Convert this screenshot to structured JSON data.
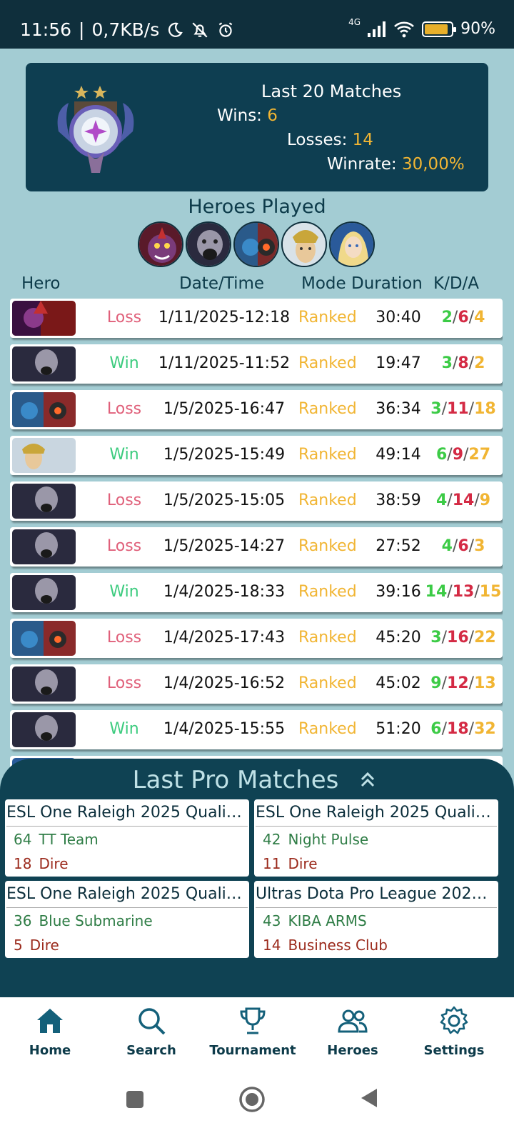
{
  "status_bar": {
    "time": "11:56",
    "speed": "0,7KB/s",
    "network": "4G",
    "battery": "90%",
    "battery_level": 0.9,
    "icons": [
      "moon-icon",
      "bell-off-icon",
      "alarm-icon",
      "signal-icon",
      "wifi-icon",
      "battery-icon"
    ]
  },
  "summary": {
    "title": "Last 20 Matches",
    "wins_label": "Wins: ",
    "wins": "6",
    "losses_label": "Losses: ",
    "losses": "14",
    "winrate_label": "Winrate: ",
    "winrate": "30,00%"
  },
  "heroes_played": {
    "title": "Heroes Played",
    "count": 5
  },
  "columns": {
    "hero": "Hero",
    "datetime": "Date/Time",
    "mode_duration": "Mode Duration",
    "kda": "K/D/A"
  },
  "matches": [
    {
      "result": "Loss",
      "datetime": "1/11/2025-12:18",
      "mode": "Ranked",
      "duration": "30:40",
      "k": "2",
      "d": "6",
      "a": "4"
    },
    {
      "result": "Win",
      "datetime": "1/11/2025-11:52",
      "mode": "Ranked",
      "duration": "19:47",
      "k": "3",
      "d": "8",
      "a": "2"
    },
    {
      "result": "Loss",
      "datetime": "1/5/2025-16:47",
      "mode": "Ranked",
      "duration": "36:34",
      "k": "3",
      "d": "11",
      "a": "18"
    },
    {
      "result": "Win",
      "datetime": "1/5/2025-15:49",
      "mode": "Ranked",
      "duration": "49:14",
      "k": "6",
      "d": "9",
      "a": "27"
    },
    {
      "result": "Loss",
      "datetime": "1/5/2025-15:05",
      "mode": "Ranked",
      "duration": "38:59",
      "k": "4",
      "d": "14",
      "a": "9"
    },
    {
      "result": "Loss",
      "datetime": "1/5/2025-14:27",
      "mode": "Ranked",
      "duration": "27:52",
      "k": "4",
      "d": "6",
      "a": "3"
    },
    {
      "result": "Win",
      "datetime": "1/4/2025-18:33",
      "mode": "Ranked",
      "duration": "39:16",
      "k": "14",
      "d": "13",
      "a": "15"
    },
    {
      "result": "Loss",
      "datetime": "1/4/2025-17:43",
      "mode": "Ranked",
      "duration": "45:20",
      "k": "3",
      "d": "16",
      "a": "22"
    },
    {
      "result": "Loss",
      "datetime": "1/4/2025-16:52",
      "mode": "Ranked",
      "duration": "45:02",
      "k": "9",
      "d": "12",
      "a": "13"
    },
    {
      "result": "Win",
      "datetime": "1/4/2025-15:55",
      "mode": "Ranked",
      "duration": "51:20",
      "k": "6",
      "d": "18",
      "a": "32"
    }
  ],
  "pro_matches": {
    "title": "Last Pro Matches",
    "items": [
      {
        "league": "ESL One Raleigh 2025 Qualifi…",
        "team1_score": "64",
        "team1": "TT Team",
        "team2_score": "18",
        "team2": "Dire"
      },
      {
        "league": "ESL One Raleigh 2025 Qualifi…",
        "team1_score": "42",
        "team1": "Night Pulse",
        "team2_score": "11",
        "team2": "Dire"
      },
      {
        "league": "ESL One Raleigh 2025 Qualifi…",
        "team1_score": "36",
        "team1": "Blue Submarine",
        "team2_score": "5",
        "team2": "Dire"
      },
      {
        "league": "Ultras Dota Pro League  202…",
        "team1_score": "43",
        "team1": "KIBA ARMS",
        "team2_score": "14",
        "team2": "Business Club"
      }
    ]
  },
  "nav": {
    "home": "Home",
    "search": "Search",
    "tournament": "Tournament",
    "heroes": "Heroes",
    "settings": "Settings"
  },
  "colors": {
    "background": "#a3ccd3",
    "panel": "#0e3e51",
    "accent_gold": "#f1b533",
    "win": "#3ccb7e",
    "loss": "#e0607a"
  }
}
